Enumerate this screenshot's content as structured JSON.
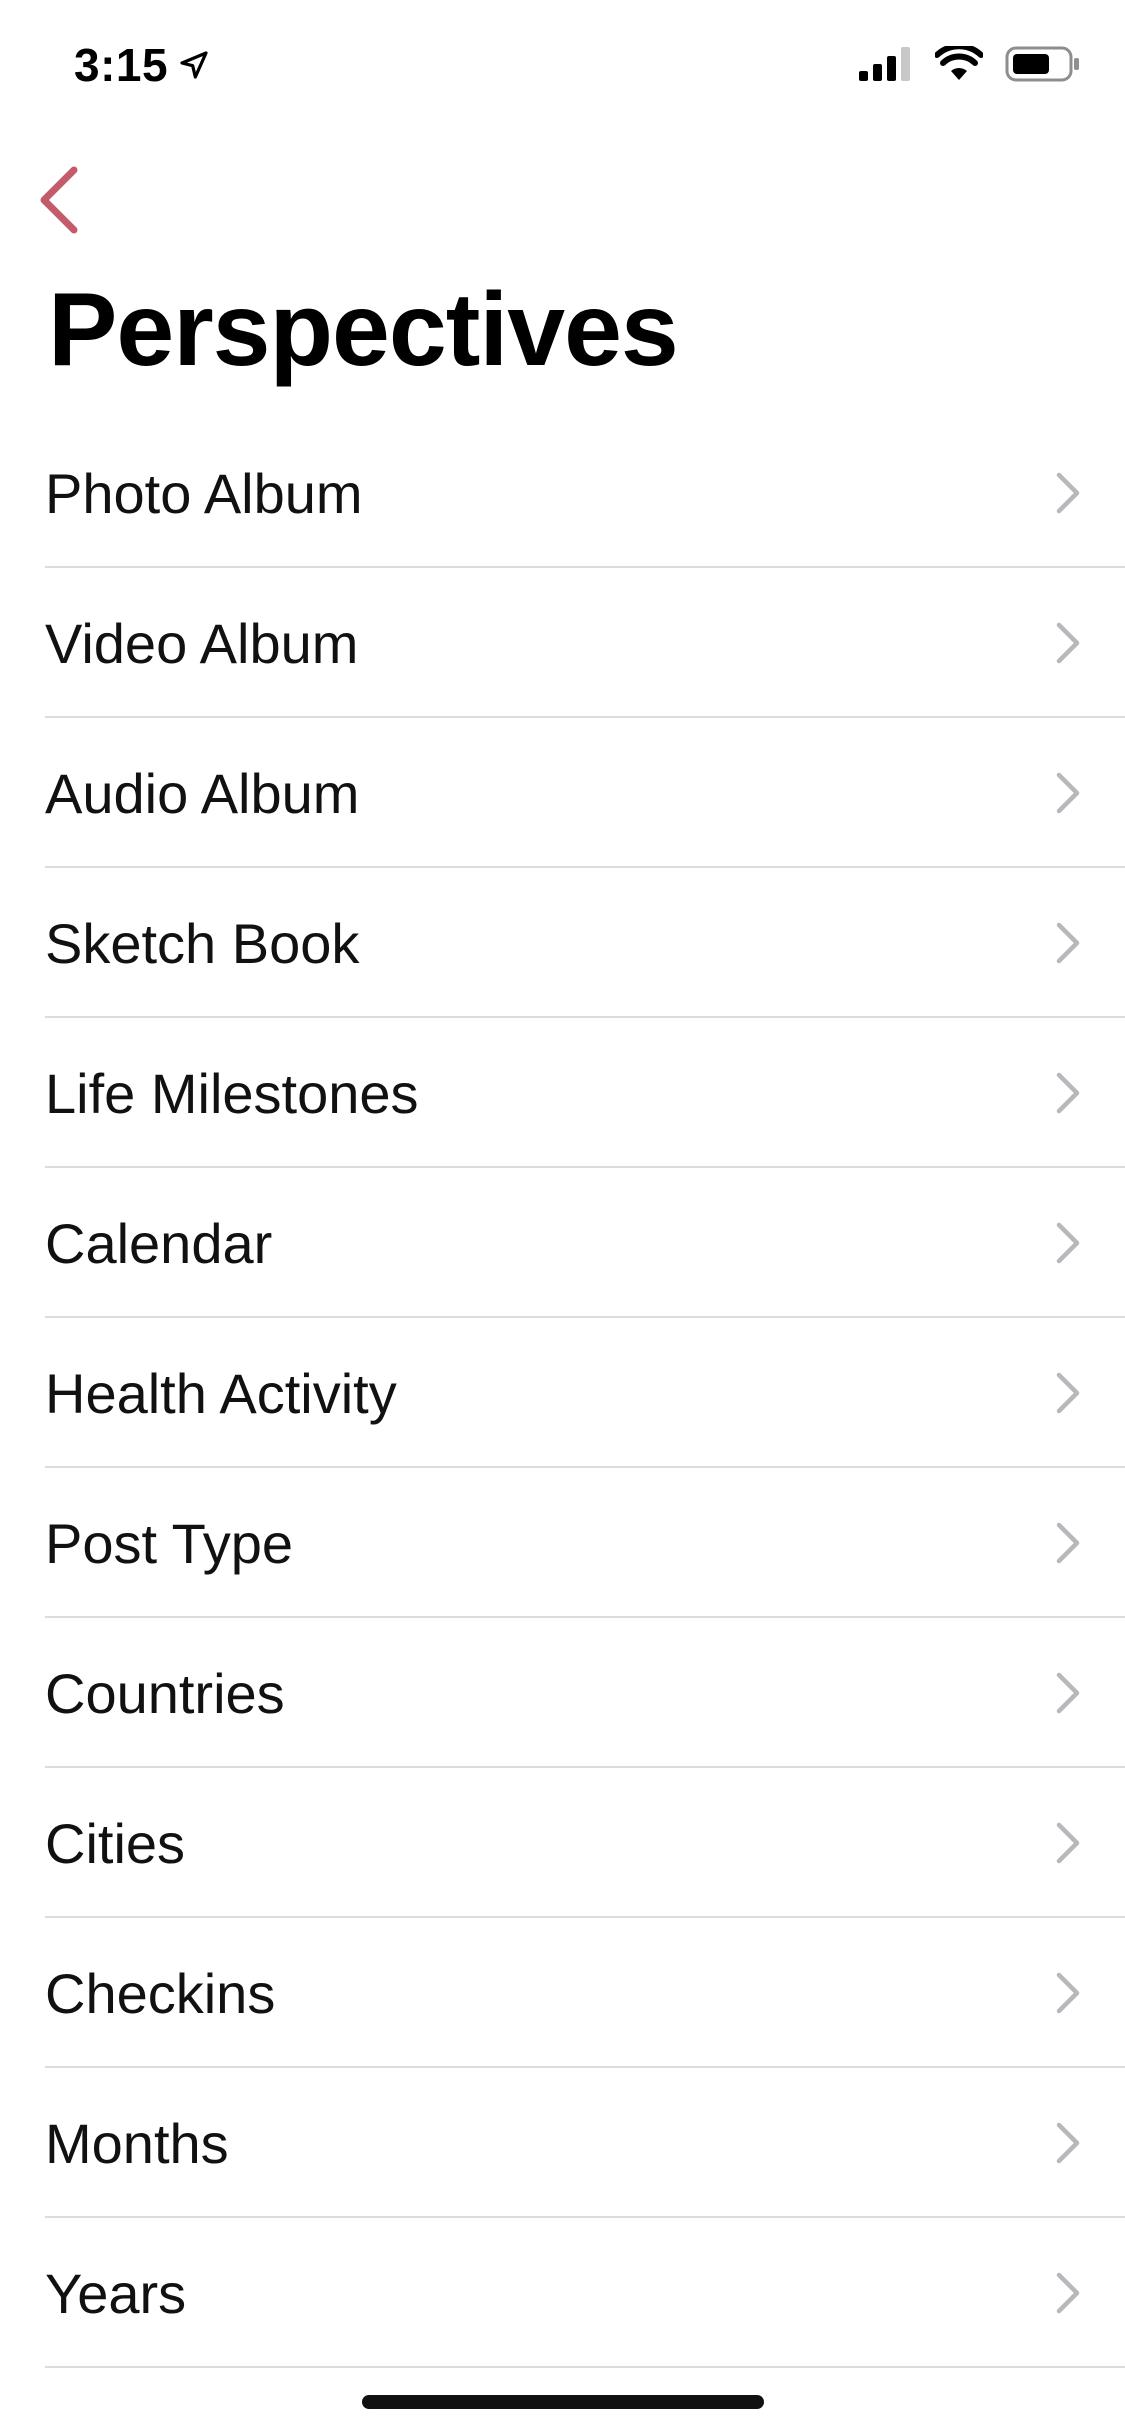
{
  "status_bar": {
    "time": "3:15",
    "icons": [
      "location-arrow-icon",
      "cellular-signal-icon",
      "wifi-icon",
      "battery-icon"
    ]
  },
  "nav": {
    "back_icon": "chevron-left-icon",
    "accent_color": "#C25B6A"
  },
  "page": {
    "title": "Perspectives"
  },
  "list": {
    "items": [
      {
        "label": "Photo Album"
      },
      {
        "label": "Video Album"
      },
      {
        "label": "Audio Album"
      },
      {
        "label": "Sketch Book"
      },
      {
        "label": "Life Milestones"
      },
      {
        "label": "Calendar"
      },
      {
        "label": "Health Activity"
      },
      {
        "label": "Post Type"
      },
      {
        "label": "Countries"
      },
      {
        "label": "Cities"
      },
      {
        "label": "Checkins"
      },
      {
        "label": "Months"
      },
      {
        "label": "Years"
      }
    ],
    "disclosure_icon": "chevron-right-icon"
  }
}
